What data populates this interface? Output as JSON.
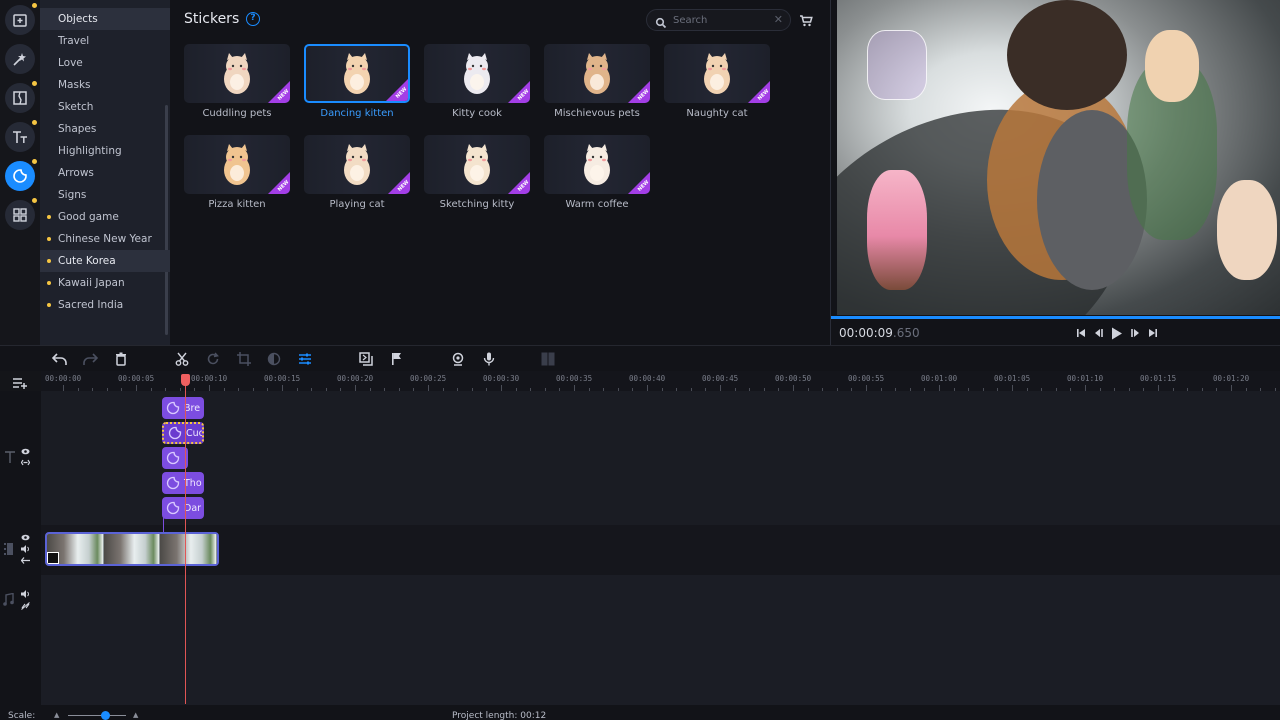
{
  "rail": {
    "items": [
      {
        "name": "import",
        "icon": "folder-plus-icon",
        "dot": true,
        "active": false
      },
      {
        "name": "effects",
        "icon": "magic-wand-icon",
        "dot": false,
        "active": false
      },
      {
        "name": "transitions",
        "icon": "transition-icon",
        "dot": true,
        "active": false
      },
      {
        "name": "titles",
        "icon": "text-icon",
        "dot": true,
        "active": false
      },
      {
        "name": "stickers",
        "icon": "sticker-icon",
        "dot": true,
        "active": true
      },
      {
        "name": "more-tools",
        "icon": "grid-icon",
        "dot": true,
        "active": false
      }
    ]
  },
  "categories": [
    {
      "label": "Objects",
      "bullet": false,
      "active": true
    },
    {
      "label": "Travel",
      "bullet": false,
      "active": false
    },
    {
      "label": "Love",
      "bullet": false,
      "active": false
    },
    {
      "label": "Masks",
      "bullet": false,
      "active": false
    },
    {
      "label": "Sketch",
      "bullet": false,
      "active": false
    },
    {
      "label": "Shapes",
      "bullet": false,
      "active": false
    },
    {
      "label": "Highlighting",
      "bullet": false,
      "active": false
    },
    {
      "label": "Arrows",
      "bullet": false,
      "active": false
    },
    {
      "label": "Signs",
      "bullet": false,
      "active": false
    },
    {
      "label": "Good game",
      "bullet": true,
      "active": false
    },
    {
      "label": "Chinese New Year",
      "bullet": true,
      "active": false
    },
    {
      "label": "Cute Korea",
      "bullet": true,
      "active": true
    },
    {
      "label": "Kawaii Japan",
      "bullet": true,
      "active": false
    },
    {
      "label": "Sacred India",
      "bullet": true,
      "active": false
    }
  ],
  "stickers": {
    "title": "Stickers",
    "help": "?",
    "search_placeholder": "Search",
    "search_value": "",
    "new_badge": "NEW",
    "items": [
      {
        "label": "Cuddling pets",
        "selected": false,
        "new": true,
        "color": "#f0d6c0"
      },
      {
        "label": "Dancing kitten",
        "selected": true,
        "new": true,
        "color": "#f3d3b0"
      },
      {
        "label": "Kitty cook",
        "selected": false,
        "new": true,
        "color": "#eceaf0"
      },
      {
        "label": "Mischievous pets",
        "selected": false,
        "new": true,
        "color": "#e0b48a"
      },
      {
        "label": "Naughty cat",
        "selected": false,
        "new": true,
        "color": "#f1d2b2"
      },
      {
        "label": "Pizza kitten",
        "selected": false,
        "new": true,
        "color": "#f0c490"
      },
      {
        "label": "Playing cat",
        "selected": false,
        "new": true,
        "color": "#f2dcc4"
      },
      {
        "label": "Sketching kitty",
        "selected": false,
        "new": true,
        "color": "#f4e4cf"
      },
      {
        "label": "Warm coffee",
        "selected": false,
        "new": true,
        "color": "#f6ece2"
      }
    ]
  },
  "preview": {
    "timecode_main": "00:00:09",
    "timecode_ms": ".650",
    "progress_fraction": 1.0,
    "controls": [
      "skip-to-start",
      "previous-frame",
      "play",
      "next-frame",
      "skip-to-end"
    ]
  },
  "timeline": {
    "toolbar": [
      "undo",
      "redo",
      "delete",
      "cut",
      "rotate",
      "crop",
      "color-adjust",
      "clip-properties",
      "overlay",
      "marker",
      "webcam-record",
      "voice-record",
      "multicam"
    ],
    "ruler_labels": [
      "00:00:00",
      "00:00:05",
      "00:00:10",
      "00:00:15",
      "00:00:20",
      "00:00:25",
      "00:00:30",
      "00:00:35",
      "00:00:40",
      "00:00:45",
      "00:00:50",
      "00:00:55",
      "00:01:00",
      "00:01:05",
      "00:01:10",
      "00:01:15",
      "00:01:20"
    ],
    "sticker_clips": [
      {
        "label": "Bre",
        "selected": false,
        "short": false
      },
      {
        "label": "Cuc",
        "selected": true,
        "short": false
      },
      {
        "label": "",
        "selected": false,
        "short": true
      },
      {
        "label": "Tho",
        "selected": false,
        "short": false
      },
      {
        "label": "Dar",
        "selected": false,
        "short": false
      }
    ],
    "video_clip_frames": 3,
    "playhead_seconds": 9.65
  },
  "status": {
    "scale_label": "Scale:",
    "scale_value": 0.65,
    "project_length_label": "Project length:",
    "project_length": "00:12"
  }
}
